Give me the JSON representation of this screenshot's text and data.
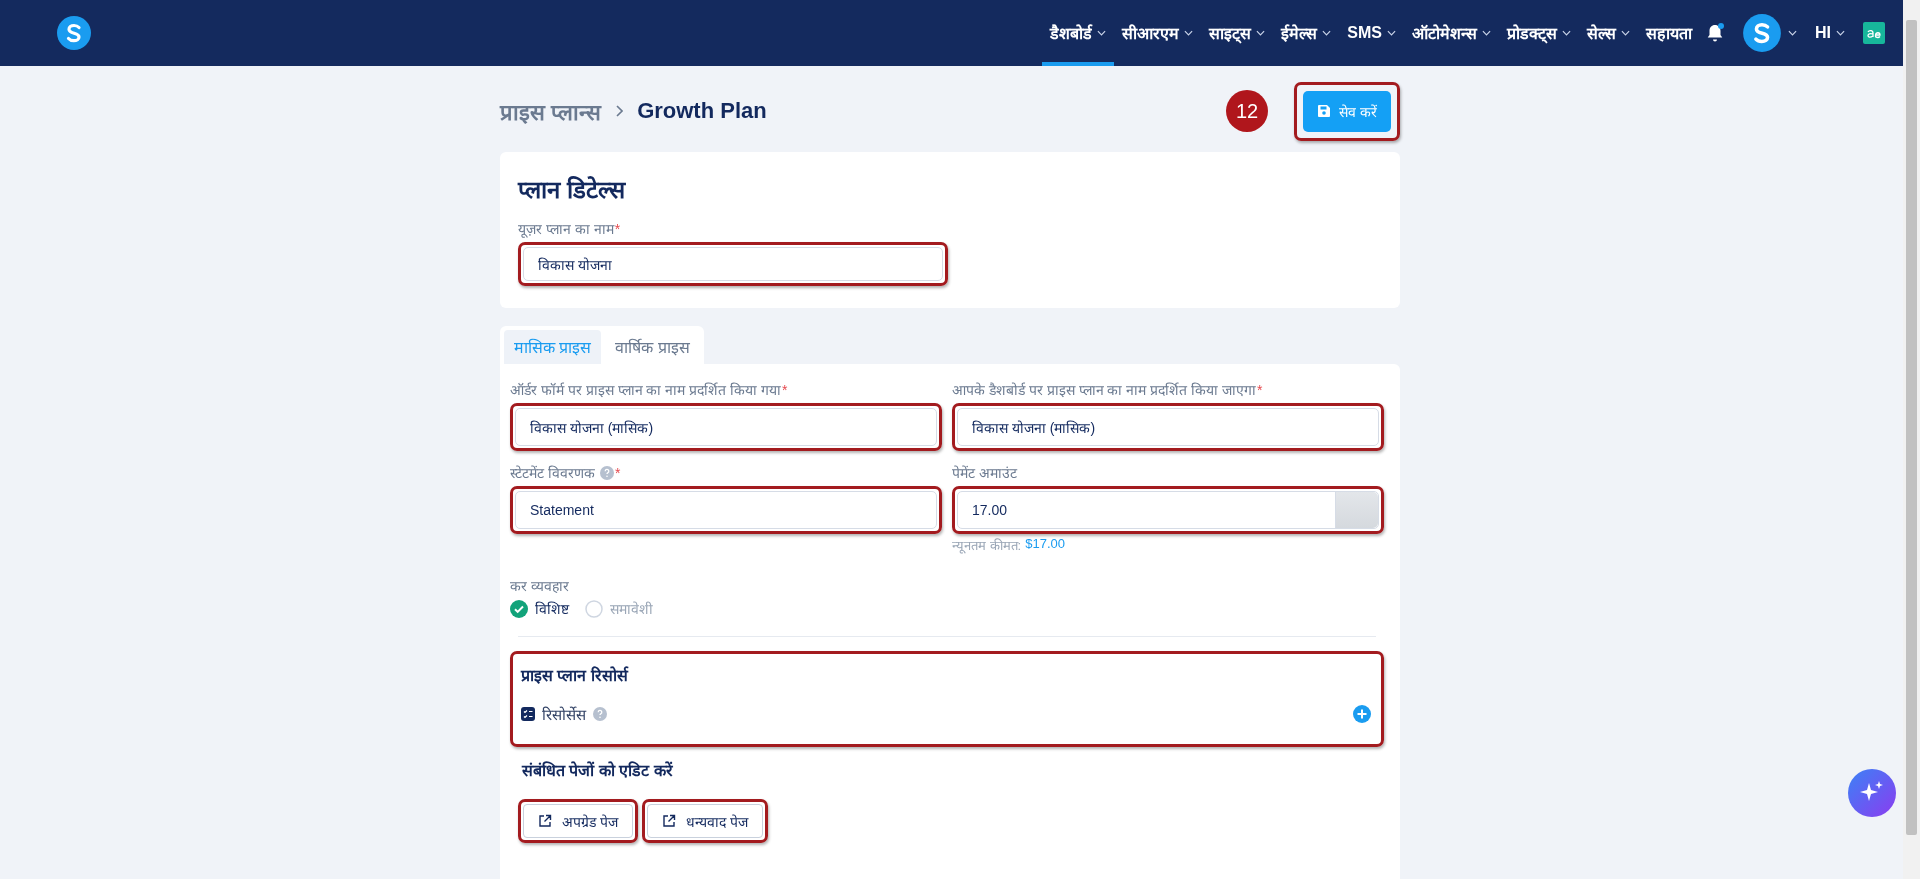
{
  "nav": {
    "items": [
      {
        "label": "डैशबोर्ड",
        "selected": true,
        "dropdown": true
      },
      {
        "label": "सीआरएम",
        "selected": false,
        "dropdown": true
      },
      {
        "label": "साइट्स",
        "selected": false,
        "dropdown": true
      },
      {
        "label": "ईमेल्स",
        "selected": false,
        "dropdown": true
      },
      {
        "label": "SMS",
        "selected": false,
        "dropdown": true
      },
      {
        "label": "ऑटोमेशन्स",
        "selected": false,
        "dropdown": true
      },
      {
        "label": "प्रोडक्ट्स",
        "selected": false,
        "dropdown": true
      },
      {
        "label": "सेल्स",
        "selected": false,
        "dropdown": true
      },
      {
        "label": "सहायता",
        "selected": false,
        "dropdown": false
      }
    ],
    "notification_dot": true,
    "language": "HI"
  },
  "breadcrumb": [
    "प्राइस प्लान्स",
    "Growth Plan"
  ],
  "annotation_badge": "12",
  "save_button": {
    "label": "सेव करें",
    "highlighted": true
  },
  "plan_details": {
    "title": "प्लान डिटेल्स",
    "field": {
      "label": "यूज़र प्लान का नाम",
      "required_mark": "*",
      "value": "विकास योजना",
      "highlighted": true
    }
  },
  "tabs": [
    {
      "label": "मासिक प्राइस",
      "selected": true
    },
    {
      "label": "वार्षिक प्राइस",
      "selected": false
    }
  ],
  "fields": [
    {
      "label": "ऑर्डर फॉर्म पर प्राइस प्लान का नाम प्रदर्शित किया गया",
      "required_mark": "*",
      "value": "विकास योजना (मासिक)",
      "highlighted": true
    },
    {
      "label": "आपके डैशबोर्ड पर प्राइस प्लान का नाम प्रदर्शित किया जाएगा",
      "required_mark": "*",
      "value": "विकास योजना (मासिक)",
      "highlighted": true
    },
    {
      "label": "स्टेटमेंट विवरणक",
      "required_mark": "*",
      "help": true,
      "value": "Statement",
      "highlighted": true
    },
    {
      "label": "पेमेंट अमाउंट",
      "value": "17.00",
      "highlighted": true,
      "addon": true,
      "hint": "न्यूनतम कीमत:",
      "hint_value": "$17.00"
    }
  ],
  "tax": {
    "label": "कर व्यवहार",
    "options": [
      {
        "label": "विशिष्ट",
        "selected": true
      },
      {
        "label": "समावेशी",
        "selected": false
      }
    ]
  },
  "resources": {
    "title": "प्राइस प्लान रिसोर्स",
    "item": "रिसोर्सेस",
    "highlighted": true
  },
  "related": {
    "title": "संबंधित पेजों को एडिट करें",
    "buttons": [
      {
        "label": "अपग्रेड पेज",
        "highlighted": true
      },
      {
        "label": "धन्यवाद पेज",
        "highlighted": true
      }
    ]
  }
}
